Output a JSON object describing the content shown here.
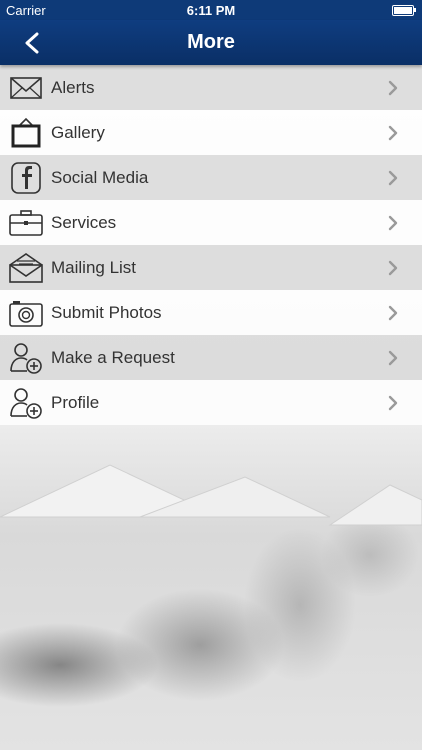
{
  "status_bar": {
    "carrier": "Carrier",
    "time": "6:11 PM"
  },
  "nav": {
    "title": "More",
    "back_icon": "chevron-left-icon"
  },
  "menu": {
    "items": [
      {
        "label": "Alerts",
        "icon": "envelope-icon"
      },
      {
        "label": "Gallery",
        "icon": "picture-frame-icon"
      },
      {
        "label": "Social Media",
        "icon": "facebook-icon"
      },
      {
        "label": "Services",
        "icon": "briefcase-icon"
      },
      {
        "label": "Mailing List",
        "icon": "open-envelope-icon"
      },
      {
        "label": "Submit Photos",
        "icon": "camera-icon"
      },
      {
        "label": "Make a Request",
        "icon": "user-add-icon"
      },
      {
        "label": "Profile",
        "icon": "user-add-icon"
      }
    ]
  },
  "colors": {
    "nav_background": "#0e3a78",
    "row_text": "#333333",
    "chevron": "#9a9a9a"
  }
}
